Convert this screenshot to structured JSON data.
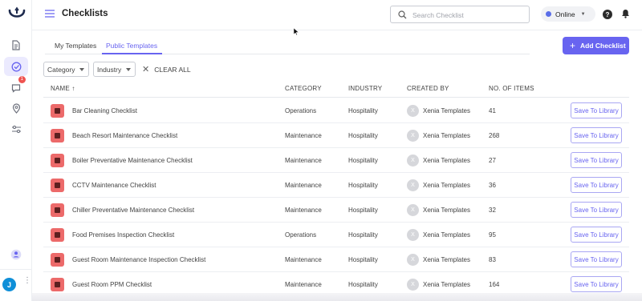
{
  "header": {
    "title": "Checklists",
    "search_placeholder": "Search Checklist",
    "status": "Online"
  },
  "rail": {
    "chat_badge": "1",
    "user_initial": "J"
  },
  "tabs": [
    {
      "label": "My Templates",
      "active": false
    },
    {
      "label": "Public Templates",
      "active": true
    }
  ],
  "add_button": "Add Checklist",
  "filters": {
    "category": "Category",
    "industry": "Industry",
    "clear_all": "CLEAR ALL"
  },
  "table": {
    "columns": {
      "name": "NAME ↑",
      "category": "CATEGORY",
      "industry": "INDUSTRY",
      "created_by": "CREATED BY",
      "items": "NO. OF ITEMS"
    },
    "save_label": "Save To Library",
    "rows": [
      {
        "name": "Bar Cleaning Checklist",
        "category": "Operations",
        "industry": "Hospitality",
        "creator_initial": "X",
        "creator": "Xenia Templates",
        "items": "41",
        "icon": "bar-icon"
      },
      {
        "name": "Beach Resort Maintenance Checklist",
        "category": "Maintenance",
        "industry": "Hospitality",
        "creator_initial": "X",
        "creator": "Xenia Templates",
        "items": "268",
        "icon": "beach-icon"
      },
      {
        "name": "Boiler Preventative Maintenance Checklist",
        "category": "Maintenance",
        "industry": "Hospitality",
        "creator_initial": "X",
        "creator": "Xenia Templates",
        "items": "27",
        "icon": "tools-icon"
      },
      {
        "name": "CCTV Maintenance Checklist",
        "category": "Maintenance",
        "industry": "Hospitality",
        "creator_initial": "X",
        "creator": "Xenia Templates",
        "items": "36",
        "icon": "camera-icon"
      },
      {
        "name": "Chiller Preventative Maintenance Checklist",
        "category": "Maintenance",
        "industry": "Hospitality",
        "creator_initial": "X",
        "creator": "Xenia Templates",
        "items": "32",
        "icon": "thermometer-icon"
      },
      {
        "name": "Food Premises Inspection Checklist",
        "category": "Operations",
        "industry": "Hospitality",
        "creator_initial": "X",
        "creator": "Xenia Templates",
        "items": "95",
        "icon": "truck-icon"
      },
      {
        "name": "Guest Room Maintenance Inspection Checklist",
        "category": "Maintenance",
        "industry": "Hospitality",
        "creator_initial": "X",
        "creator": "Xenia Templates",
        "items": "83",
        "icon": "bed-icon"
      },
      {
        "name": "Guest Room PPM Checklist",
        "category": "Maintenance",
        "industry": "Hospitality",
        "creator_initial": "X",
        "creator": "Xenia Templates",
        "items": "164",
        "icon": "bed-icon"
      }
    ]
  }
}
